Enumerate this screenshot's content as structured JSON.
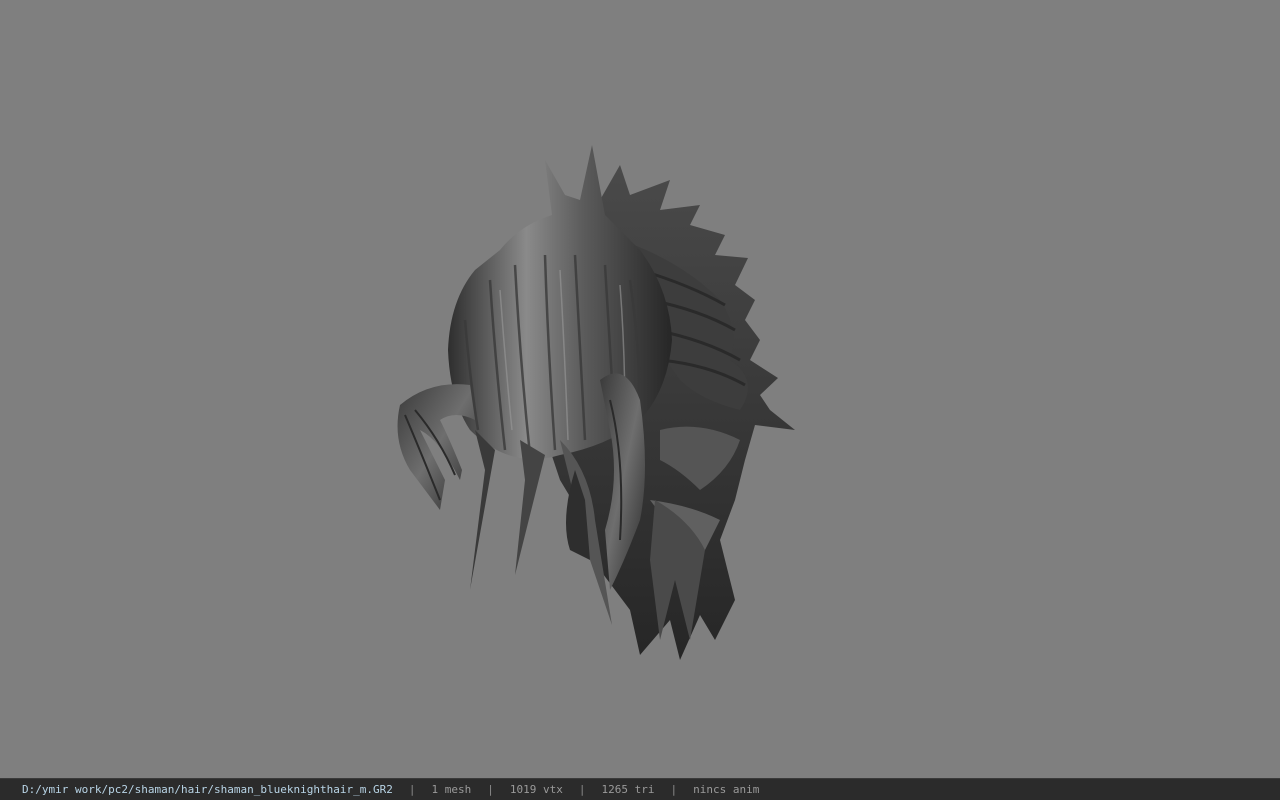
{
  "viewport": {
    "background": "#7f7f7f",
    "model": "hair-mesh-render"
  },
  "status_bar": {
    "file_path": "D:/ymir work/pc2/shaman/hair/shaman_blueknighthair_m.GR2",
    "mesh_count": "1 mesh",
    "vertex_count": "1019 vtx",
    "triangle_count": "1265 tri",
    "anim_info": "nincs anim",
    "separator": "|"
  },
  "colors": {
    "status_bg": "#2b2b2b",
    "path_text": "#b8d4e6",
    "stat_text": "#9a9a9a"
  }
}
